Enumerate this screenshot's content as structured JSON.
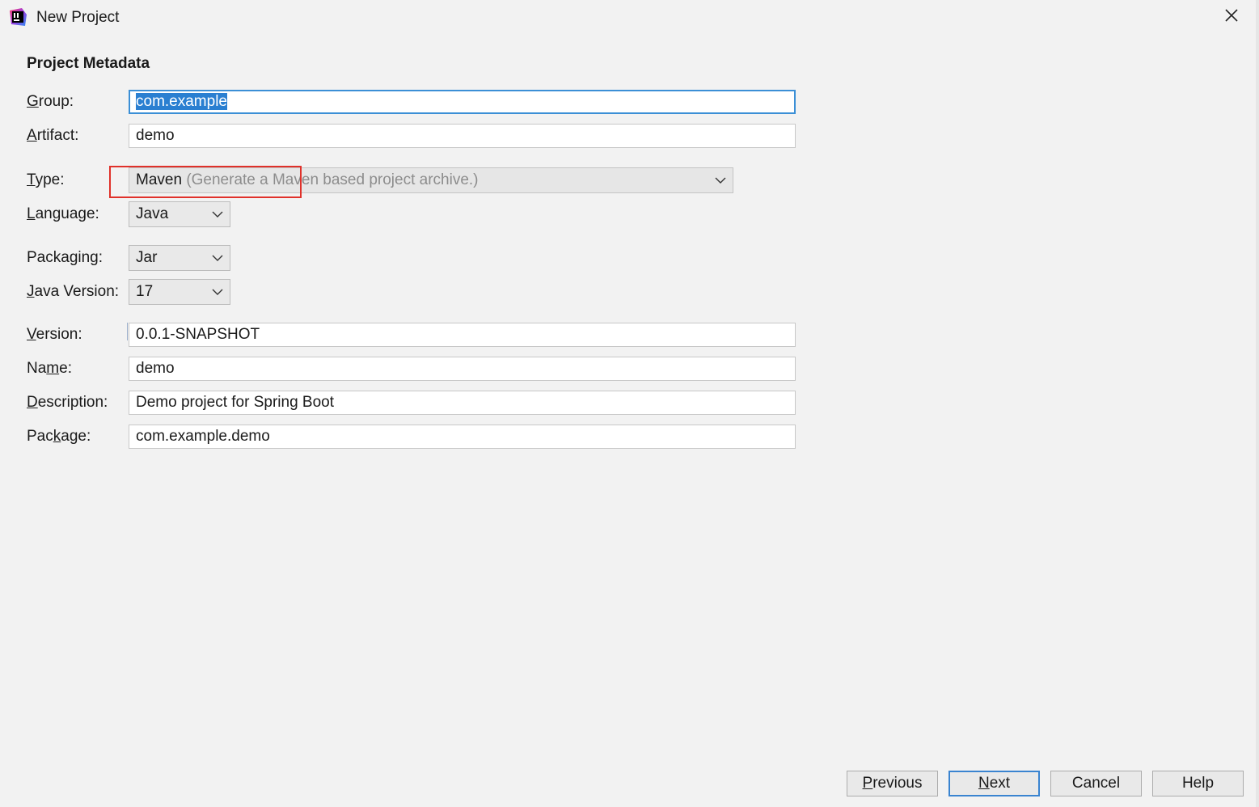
{
  "window": {
    "title": "New Project",
    "icon": "intellij-idea-icon",
    "close_icon": "close-icon"
  },
  "section_title": "Project Metadata",
  "fields": {
    "group": {
      "label_pre": "",
      "label_key": "G",
      "label_post": "roup:",
      "value": "com.example"
    },
    "artifact": {
      "label_pre": "",
      "label_key": "A",
      "label_post": "rtifact:",
      "value": "demo"
    },
    "type": {
      "label_pre": "",
      "label_key": "T",
      "label_post": "ype:",
      "value": "Maven",
      "hint": "(Generate a Maven based project archive.)"
    },
    "language": {
      "label_pre": "",
      "label_key": "L",
      "label_post": "anguage:",
      "value": "Java"
    },
    "packaging": {
      "label_pre": "Packa",
      "label_key": "g",
      "label_post": "ing:",
      "value": "Jar"
    },
    "java_version": {
      "label_pre": "",
      "label_key": "J",
      "label_post": "ava Version:",
      "value": "17"
    },
    "version": {
      "label_pre": "",
      "label_key": "V",
      "label_post": "ersion:",
      "value": "0.0.1-SNAPSHOT"
    },
    "name": {
      "label_pre": "Na",
      "label_key": "m",
      "label_post": "e:",
      "value": "demo"
    },
    "description": {
      "label_pre": "",
      "label_key": "D",
      "label_post": "escription:",
      "value": "Demo project for Spring Boot"
    },
    "package": {
      "label_pre": "Pac",
      "label_key": "k",
      "label_post": "age:",
      "value": "com.example.demo"
    }
  },
  "buttons": {
    "previous": {
      "pre": "",
      "key": "P",
      "post": "revious"
    },
    "next": {
      "pre": "",
      "key": "N",
      "post": "ext"
    },
    "cancel": {
      "label": "Cancel"
    },
    "help": {
      "label": "Help"
    }
  },
  "colors": {
    "focus_border": "#3b8fd6",
    "selection": "#2a7fd1",
    "annotation_box": "#e0312a"
  }
}
